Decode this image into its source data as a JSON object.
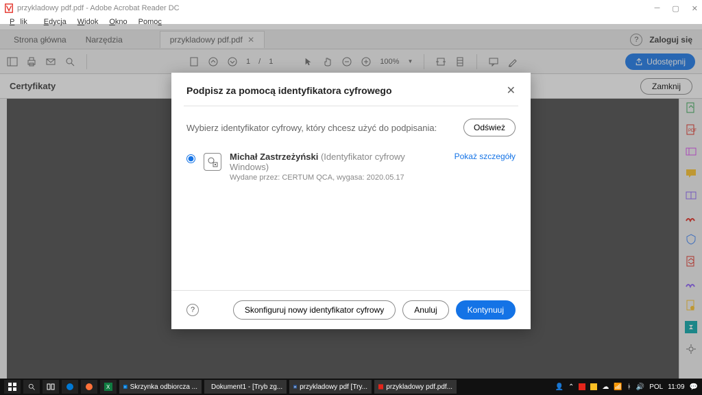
{
  "titlebar": {
    "title": "przykladowy pdf.pdf - Adobe Acrobat Reader DC"
  },
  "menubar": {
    "plik": "Plik",
    "edycja": "Edycja",
    "widok": "Widok",
    "okno": "Okno",
    "pomoc": "Pomoc"
  },
  "tabbar": {
    "home": "Strona główna",
    "tools": "Narzędzia",
    "file": "przykladowy pdf.pdf",
    "login": "Zaloguj się"
  },
  "toolbar": {
    "page_cur": "1",
    "page_sep": "/",
    "page_total": "1",
    "zoom": "100%",
    "share": "Udostępnij"
  },
  "certbar": {
    "title": "Certyfikaty",
    "close": "Zamknij"
  },
  "dialog": {
    "title": "Podpisz za pomocą identyfikatora cyfrowego",
    "instruction": "Wybierz identyfikator cyfrowy, który chcesz użyć do podpisania:",
    "refresh": "Odśwież",
    "id": {
      "name": "Michał Zastrzeżyński",
      "type": "(Identyfikator cyfrowy Windows)",
      "issuer": "Wydane przez: CERTUM QCA, wygasa: 2020.05.17",
      "detail": "Pokaż szczegóły"
    },
    "configure": "Skonfiguruj nowy identyfikator cyfrowy",
    "cancel": "Anuluj",
    "continue": "Kontynuuj"
  },
  "taskbar": {
    "apps": {
      "outlook": "Skrzynka odbiorcza ...",
      "word1": "Dokument1 - [Tryb zg...",
      "word2": "przykladowy pdf [Try...",
      "acrobat": "przykladowy pdf.pdf..."
    },
    "lang": "POL",
    "time": "11:09"
  }
}
